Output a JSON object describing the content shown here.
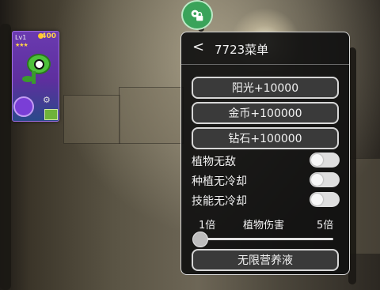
{
  "card": {
    "level": "Lv1",
    "cost": "400",
    "stars": "★★★"
  },
  "menu": {
    "title": "7723菜单",
    "buttons": {
      "sun": "阳光+10000",
      "coins": "金币+100000",
      "gems": "钻石+100000",
      "nutrient": "无限营养液"
    },
    "toggles": [
      {
        "label": "植物无敌",
        "state": "off"
      },
      {
        "label": "种植无冷却",
        "state": "off"
      },
      {
        "label": "技能无冷却",
        "state": "off"
      }
    ],
    "slider": {
      "min_label": "1倍",
      "name": "植物伤害",
      "max_label": "5倍",
      "value": 1
    }
  },
  "colors": {
    "panel_bg": "#101010",
    "button_border": "#d7d7d7",
    "lock_button": "#3aa35a"
  },
  "icons": [
    "back-chevron-icon",
    "lock-icon",
    "gear-icon"
  ]
}
